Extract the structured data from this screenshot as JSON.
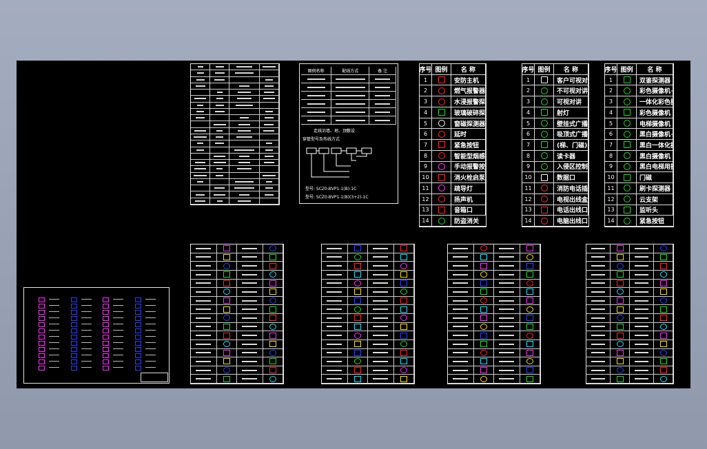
{
  "legend_headers": [
    "序号",
    "图例",
    "名  称"
  ],
  "legend_tables": [
    {
      "items": [
        {
          "n": "1",
          "label": "安防主机",
          "icon": "host-icon",
          "color": "#ff2a2a"
        },
        {
          "n": "2",
          "label": "燃气报警器",
          "icon": "gas-alarm-icon",
          "color": "#ff2a2a"
        },
        {
          "n": "3",
          "label": "水浸报警探测器",
          "icon": "water-sensor-icon",
          "color": "#ff2a2a"
        },
        {
          "n": "4",
          "label": "玻璃破碎探测器",
          "icon": "glass-break-icon",
          "color": "#22dd22"
        },
        {
          "n": "5",
          "label": "窗磁探测器",
          "icon": "window-contact-icon",
          "color": "#ffffff"
        },
        {
          "n": "6",
          "label": "延时",
          "icon": "delay-icon",
          "color": "#ff2a2a"
        },
        {
          "n": "7",
          "label": "紧急按钮",
          "icon": "panic-button-icon",
          "color": "#ff2a2a"
        },
        {
          "n": "8",
          "label": "智能型烟感",
          "icon": "smoke-detector-icon",
          "color": "#ff2a2a"
        },
        {
          "n": "9",
          "label": "手动报警按钮",
          "icon": "manual-alarm-icon",
          "color": "#ff44ff"
        },
        {
          "n": "10",
          "label": "消火栓启泵按钮",
          "icon": "hydrant-button-icon",
          "color": "#ff2a2a"
        },
        {
          "n": "11",
          "label": "疏导灯",
          "icon": "exit-light-icon",
          "color": "#ff44ff"
        },
        {
          "n": "12",
          "label": "扬声机",
          "icon": "speaker-icon",
          "color": "#ff2a2a"
        },
        {
          "n": "13",
          "label": "音箱口",
          "icon": "audio-outlet-icon",
          "color": "#ff2a2a"
        },
        {
          "n": "14",
          "label": "防盗消关",
          "icon": "security-switch-icon",
          "color": "#22dd22"
        }
      ]
    },
    {
      "items": [
        {
          "n": "1",
          "label": "客户可视对讲分机",
          "icon": "intercom-icon",
          "color": "#ffffff"
        },
        {
          "n": "2",
          "label": "不可视对讲",
          "icon": "audio-intercom-icon",
          "color": "#22dd22"
        },
        {
          "n": "3",
          "label": "可视对讲",
          "icon": "video-intercom-icon",
          "color": "#22dd22"
        },
        {
          "n": "4",
          "label": "射灯",
          "icon": "spotlight-icon",
          "color": "#22dd22"
        },
        {
          "n": "5",
          "label": "壁挂式广播",
          "icon": "wall-speaker-icon",
          "color": "#22dd22"
        },
        {
          "n": "6",
          "label": "吸顶式广播",
          "icon": "ceiling-speaker-icon",
          "color": "#22dd22"
        },
        {
          "n": "7",
          "label": "(梯、门磁)门禁",
          "icon": "access-control-icon",
          "color": "#22dd22"
        },
        {
          "n": "8",
          "label": "读卡器",
          "icon": "card-reader-icon",
          "color": "#22dd22"
        },
        {
          "n": "9",
          "label": "入侵区控制器",
          "icon": "zone-controller-icon",
          "color": "#22dd22"
        },
        {
          "n": "10",
          "label": "数据口",
          "icon": "data-outlet-icon",
          "color": "#ffffff"
        },
        {
          "n": "11",
          "label": "消防电话插口",
          "icon": "fire-phone-icon",
          "color": "#ff2a2a"
        },
        {
          "n": "12",
          "label": "电视出线盒",
          "icon": "tv-outlet-icon",
          "color": "#ff2a2a"
        },
        {
          "n": "13",
          "label": "电话出线口",
          "icon": "phone-outlet-icon",
          "color": "#ff2a2a"
        },
        {
          "n": "14",
          "label": "电脑出线口",
          "icon": "pc-outlet-icon",
          "color": "#ff2a2a"
        }
      ]
    },
    {
      "items": [
        {
          "n": "1",
          "label": "双鉴探测器",
          "icon": "dual-detector-icon",
          "color": "#22dd22"
        },
        {
          "n": "2",
          "label": "彩色摄像机+云台",
          "icon": "ptz-camera-icon",
          "color": "#22dd22"
        },
        {
          "n": "3",
          "label": "一体化彩色摄像机",
          "icon": "dome-camera-icon",
          "color": "#22dd22"
        },
        {
          "n": "4",
          "label": "彩色摄像机",
          "icon": "color-camera-icon",
          "color": "#22dd22"
        },
        {
          "n": "5",
          "label": "电梯摄像机",
          "icon": "elevator-camera-icon",
          "color": "#22dd22"
        },
        {
          "n": "6",
          "label": "黑白摄像机+云台",
          "icon": "bw-ptz-camera-icon",
          "color": "#22dd22"
        },
        {
          "n": "7",
          "label": "黑白一体化摄像机",
          "icon": "bw-dome-camera-icon",
          "color": "#22dd22"
        },
        {
          "n": "8",
          "label": "黑白摄像机",
          "icon": "bw-camera-icon",
          "color": "#22dd22"
        },
        {
          "n": "9",
          "label": "黑白电梯用摄像机",
          "icon": "bw-elevator-camera-icon",
          "color": "#22dd22"
        },
        {
          "n": "10",
          "label": "门磁",
          "icon": "door-contact-icon",
          "color": "#22dd22"
        },
        {
          "n": "11",
          "label": "刷卡探测器",
          "icon": "card-detector-icon",
          "color": "#22dd22"
        },
        {
          "n": "12",
          "label": "云支架",
          "icon": "bracket-icon",
          "color": "#22dd22"
        },
        {
          "n": "13",
          "label": "监听头",
          "icon": "microphone-icon",
          "color": "#22dd22"
        },
        {
          "n": "14",
          "label": "紧急按钮",
          "icon": "emergency-button-icon",
          "color": "#22dd22"
        }
      ]
    }
  ],
  "wiring_legend": {
    "headers": [
      "图例名称",
      "配线方式",
      "备  注"
    ],
    "notes": [
      "走线沿墙、地、顶敷设",
      "穿管型号及布线方式"
    ],
    "model_1": "型号: SCZ0-BVP1-1(B)-1C",
    "model_2": "型号: SCZ0-BVP1-1(B)(3+2)-1C"
  },
  "colors": {
    "cyan": "#19e6ff",
    "magenta": "#ff33ff",
    "yellow": "#ffe21c",
    "blue": "#2b44ff",
    "green": "#22dd22",
    "red": "#ff2a2a"
  }
}
